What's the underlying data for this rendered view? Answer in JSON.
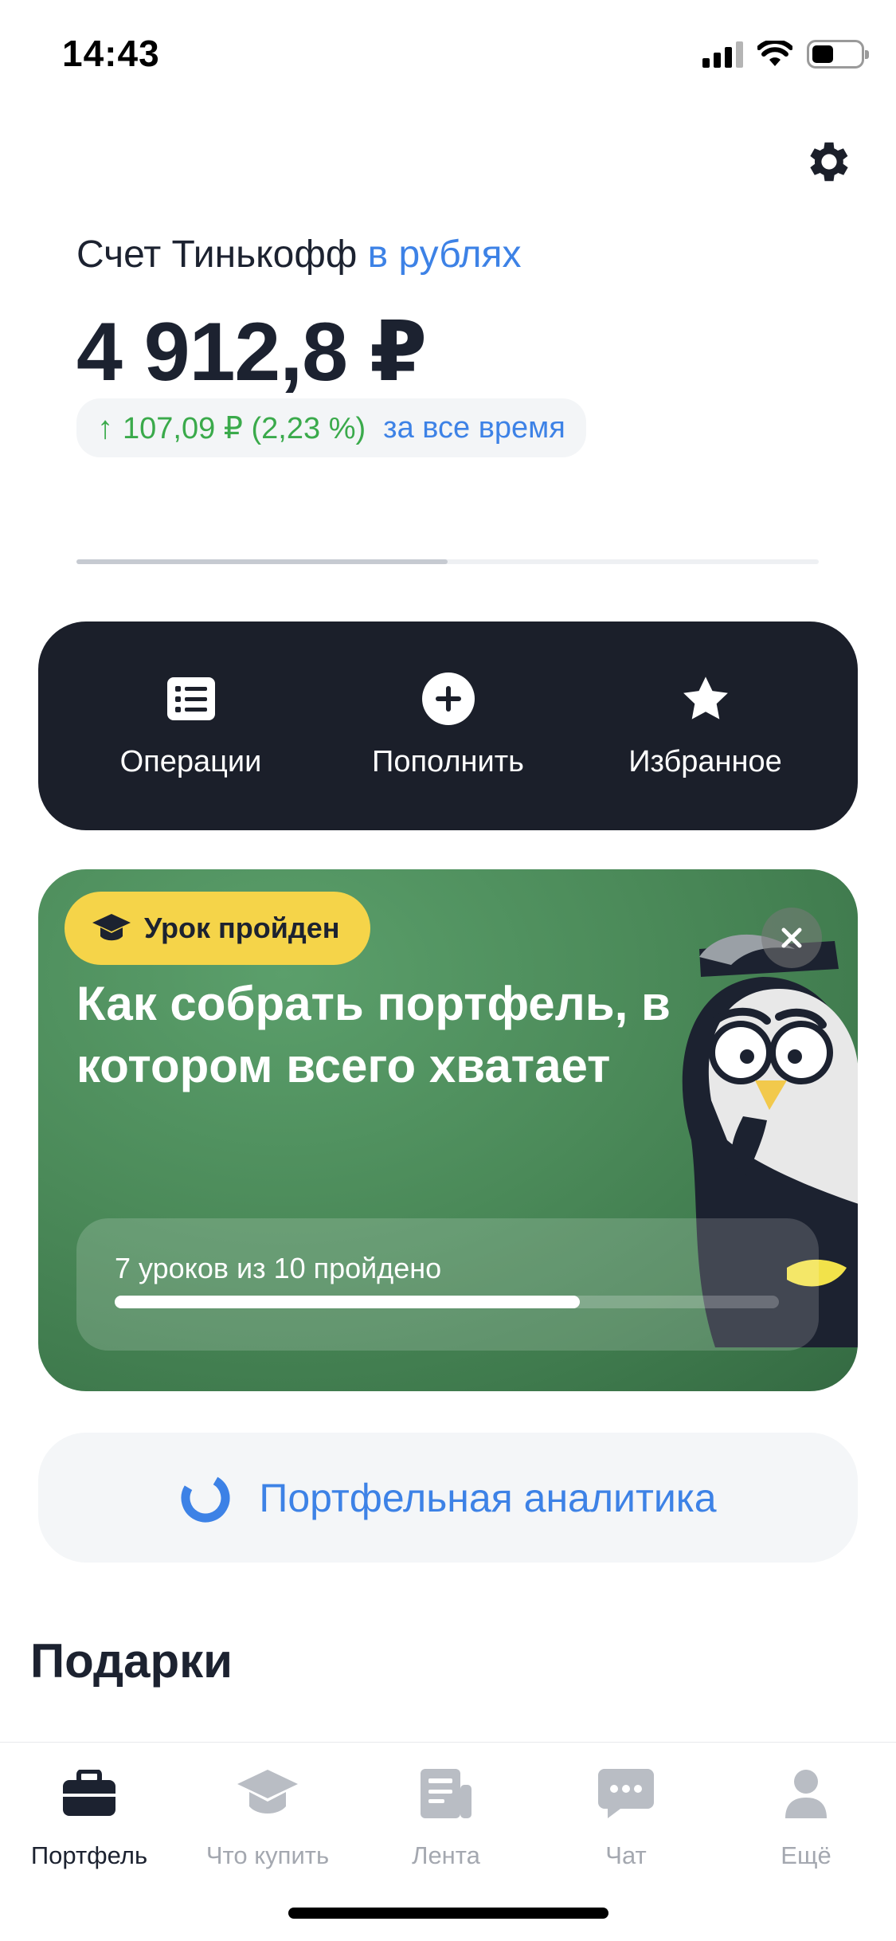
{
  "status_bar": {
    "time": "14:43",
    "icons": [
      "cellular-signal-icon",
      "wifi-icon",
      "battery-icon"
    ]
  },
  "header": {
    "settings_icon": "gear-icon"
  },
  "account": {
    "title": "Счет Тинькофф",
    "currency_label": "в рублях",
    "total": "4 912,8 ₽",
    "gain": {
      "arrow": "↑",
      "value": "107,09 ₽ (2,23 %)",
      "period": "за все время",
      "color": "#3aaa4b"
    }
  },
  "pager": {
    "pages": 2,
    "active": 1
  },
  "actions": [
    {
      "label": "Операции",
      "icon": "list-icon"
    },
    {
      "label": "Пополнить",
      "icon": "plus-circle-icon"
    },
    {
      "label": "Избранное",
      "icon": "star-icon"
    }
  ],
  "lesson": {
    "badge": "Урок пройден",
    "title": "Как собрать портфель, в котором всего хватает",
    "progress_text": "7 уроков из 10 пройдено",
    "completed": 7,
    "total": 10,
    "close_icon": "close-icon",
    "illustration": "owl-illustration"
  },
  "analytics": {
    "label": "Портфельная аналитика",
    "icon": "donut-chart-icon"
  },
  "gifts": {
    "heading": "Подарки"
  },
  "tabs": [
    {
      "label": "Портфель",
      "icon": "briefcase-icon",
      "active": true
    },
    {
      "label": "Что купить",
      "icon": "graduation-cap-icon",
      "active": false
    },
    {
      "label": "Лента",
      "icon": "newspaper-icon",
      "active": false
    },
    {
      "label": "Чат",
      "icon": "chat-bubble-icon",
      "active": false
    },
    {
      "label": "Ещё",
      "icon": "user-icon",
      "active": false
    }
  ],
  "colors": {
    "accent_blue": "#3d82e6",
    "dark": "#1b1f2a",
    "lesson_green": "#4b8a59",
    "badge_yellow": "#f5d449",
    "inactive_tab": "#a4a8b0"
  }
}
